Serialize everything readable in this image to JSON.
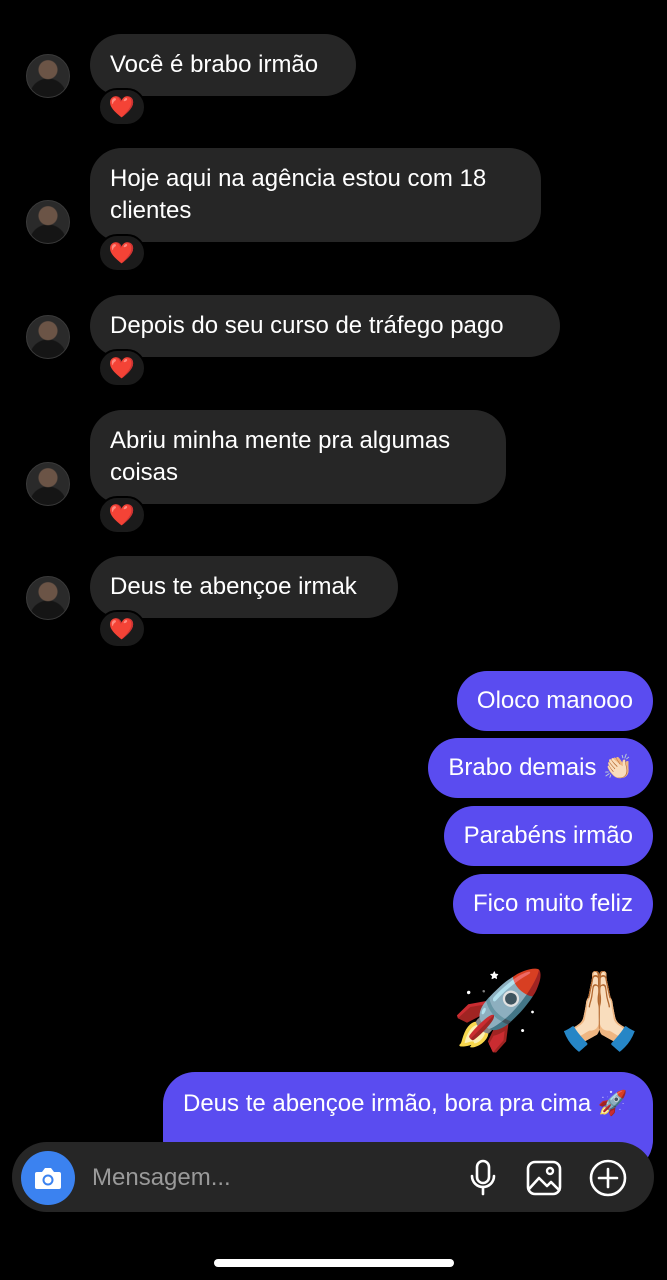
{
  "messages_incoming": [
    {
      "text": "Você é brabo irmão",
      "reaction": "❤️"
    },
    {
      "text": "Hoje aqui na agência estou com 18 clientes",
      "reaction": "❤️"
    },
    {
      "text": "Depois do seu curso de tráfego pago",
      "reaction": "❤️"
    },
    {
      "text": "Abriu minha mente pra algumas coisas",
      "reaction": "❤️"
    },
    {
      "text": "Deus te abençoe irmak",
      "reaction": "❤️"
    }
  ],
  "messages_outgoing": [
    {
      "text": "Oloco manooo"
    },
    {
      "text": "Brabo demais 👏🏻"
    },
    {
      "text": "Parabéns irmão"
    },
    {
      "text": "Fico muito feliz"
    }
  ],
  "emoji_message": "🚀🙏🏻",
  "last_outgoing": "Deus te abençoe irmão, bora pra cima 🚀",
  "composer": {
    "placeholder": "Mensagem...",
    "accent_color": "#3b82f0"
  },
  "colors": {
    "incoming_bubble": "#262626",
    "outgoing_bubble": "#5a4cf0",
    "background": "#000000"
  }
}
